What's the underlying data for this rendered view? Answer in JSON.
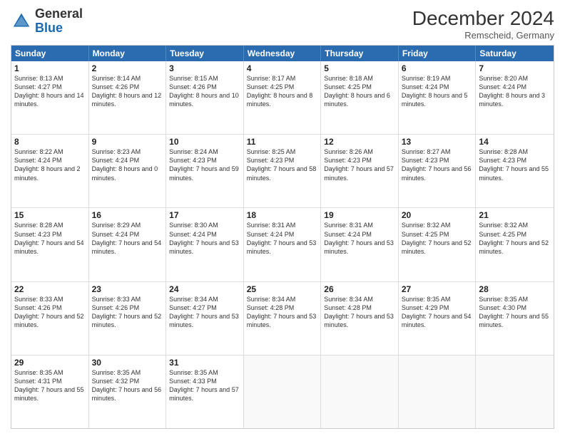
{
  "header": {
    "logo_general": "General",
    "logo_blue": "Blue",
    "month_year": "December 2024",
    "location": "Remscheid, Germany"
  },
  "days_of_week": [
    "Sunday",
    "Monday",
    "Tuesday",
    "Wednesday",
    "Thursday",
    "Friday",
    "Saturday"
  ],
  "weeks": [
    [
      {
        "day": "1",
        "sunrise": "8:13 AM",
        "sunset": "4:27 PM",
        "daylight": "8 hours and 14 minutes."
      },
      {
        "day": "2",
        "sunrise": "8:14 AM",
        "sunset": "4:26 PM",
        "daylight": "8 hours and 12 minutes."
      },
      {
        "day": "3",
        "sunrise": "8:15 AM",
        "sunset": "4:26 PM",
        "daylight": "8 hours and 10 minutes."
      },
      {
        "day": "4",
        "sunrise": "8:17 AM",
        "sunset": "4:25 PM",
        "daylight": "8 hours and 8 minutes."
      },
      {
        "day": "5",
        "sunrise": "8:18 AM",
        "sunset": "4:25 PM",
        "daylight": "8 hours and 6 minutes."
      },
      {
        "day": "6",
        "sunrise": "8:19 AM",
        "sunset": "4:24 PM",
        "daylight": "8 hours and 5 minutes."
      },
      {
        "day": "7",
        "sunrise": "8:20 AM",
        "sunset": "4:24 PM",
        "daylight": "8 hours and 3 minutes."
      }
    ],
    [
      {
        "day": "8",
        "sunrise": "8:22 AM",
        "sunset": "4:24 PM",
        "daylight": "8 hours and 2 minutes."
      },
      {
        "day": "9",
        "sunrise": "8:23 AM",
        "sunset": "4:24 PM",
        "daylight": "8 hours and 0 minutes."
      },
      {
        "day": "10",
        "sunrise": "8:24 AM",
        "sunset": "4:23 PM",
        "daylight": "7 hours and 59 minutes."
      },
      {
        "day": "11",
        "sunrise": "8:25 AM",
        "sunset": "4:23 PM",
        "daylight": "7 hours and 58 minutes."
      },
      {
        "day": "12",
        "sunrise": "8:26 AM",
        "sunset": "4:23 PM",
        "daylight": "7 hours and 57 minutes."
      },
      {
        "day": "13",
        "sunrise": "8:27 AM",
        "sunset": "4:23 PM",
        "daylight": "7 hours and 56 minutes."
      },
      {
        "day": "14",
        "sunrise": "8:28 AM",
        "sunset": "4:23 PM",
        "daylight": "7 hours and 55 minutes."
      }
    ],
    [
      {
        "day": "15",
        "sunrise": "8:28 AM",
        "sunset": "4:23 PM",
        "daylight": "7 hours and 54 minutes."
      },
      {
        "day": "16",
        "sunrise": "8:29 AM",
        "sunset": "4:24 PM",
        "daylight": "7 hours and 54 minutes."
      },
      {
        "day": "17",
        "sunrise": "8:30 AM",
        "sunset": "4:24 PM",
        "daylight": "7 hours and 53 minutes."
      },
      {
        "day": "18",
        "sunrise": "8:31 AM",
        "sunset": "4:24 PM",
        "daylight": "7 hours and 53 minutes."
      },
      {
        "day": "19",
        "sunrise": "8:31 AM",
        "sunset": "4:24 PM",
        "daylight": "7 hours and 53 minutes."
      },
      {
        "day": "20",
        "sunrise": "8:32 AM",
        "sunset": "4:25 PM",
        "daylight": "7 hours and 52 minutes."
      },
      {
        "day": "21",
        "sunrise": "8:32 AM",
        "sunset": "4:25 PM",
        "daylight": "7 hours and 52 minutes."
      }
    ],
    [
      {
        "day": "22",
        "sunrise": "8:33 AM",
        "sunset": "4:26 PM",
        "daylight": "7 hours and 52 minutes."
      },
      {
        "day": "23",
        "sunrise": "8:33 AM",
        "sunset": "4:26 PM",
        "daylight": "7 hours and 52 minutes."
      },
      {
        "day": "24",
        "sunrise": "8:34 AM",
        "sunset": "4:27 PM",
        "daylight": "7 hours and 53 minutes."
      },
      {
        "day": "25",
        "sunrise": "8:34 AM",
        "sunset": "4:28 PM",
        "daylight": "7 hours and 53 minutes."
      },
      {
        "day": "26",
        "sunrise": "8:34 AM",
        "sunset": "4:28 PM",
        "daylight": "7 hours and 53 minutes."
      },
      {
        "day": "27",
        "sunrise": "8:35 AM",
        "sunset": "4:29 PM",
        "daylight": "7 hours and 54 minutes."
      },
      {
        "day": "28",
        "sunrise": "8:35 AM",
        "sunset": "4:30 PM",
        "daylight": "7 hours and 55 minutes."
      }
    ],
    [
      {
        "day": "29",
        "sunrise": "8:35 AM",
        "sunset": "4:31 PM",
        "daylight": "7 hours and 55 minutes."
      },
      {
        "day": "30",
        "sunrise": "8:35 AM",
        "sunset": "4:32 PM",
        "daylight": "7 hours and 56 minutes."
      },
      {
        "day": "31",
        "sunrise": "8:35 AM",
        "sunset": "4:33 PM",
        "daylight": "7 hours and 57 minutes."
      },
      null,
      null,
      null,
      null
    ]
  ]
}
